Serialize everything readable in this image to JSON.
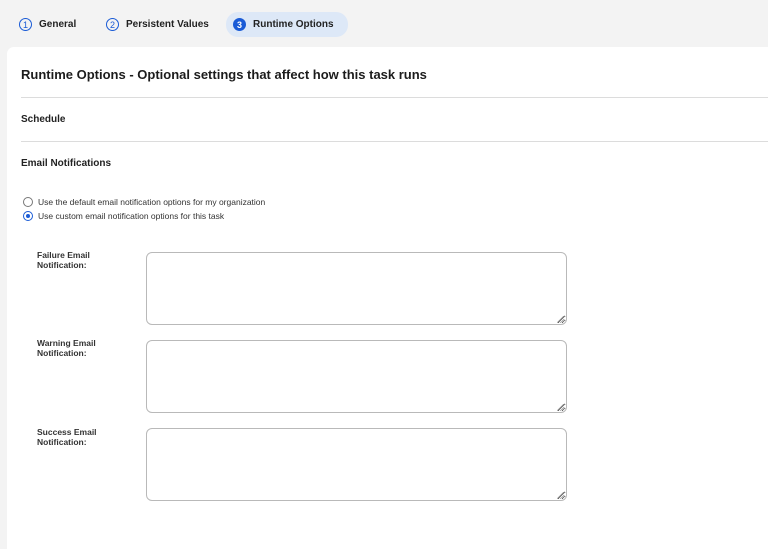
{
  "steps": [
    {
      "number": "1",
      "label": "General",
      "active": false
    },
    {
      "number": "2",
      "label": "Persistent Values",
      "active": false
    },
    {
      "number": "3",
      "label": "Runtime Options",
      "active": true
    }
  ],
  "page": {
    "title": "Runtime Options - Optional settings that affect how this task runs"
  },
  "sections": {
    "schedule": "Schedule",
    "email_notifications": "Email Notifications"
  },
  "email_options": {
    "default_label": "Use the default email notification options for my organization",
    "custom_label": "Use custom email notification options for this task",
    "selected": "custom"
  },
  "fields": {
    "failure": {
      "label": "Failure Email Notification:",
      "value": ""
    },
    "warning": {
      "label": "Warning Email Notification:",
      "value": ""
    },
    "success": {
      "label": "Success Email Notification:",
      "value": ""
    }
  },
  "colors": {
    "accent": "#1a5bd6",
    "active_tab_bg": "#dde8f7",
    "page_bg": "#f3f3f3"
  }
}
